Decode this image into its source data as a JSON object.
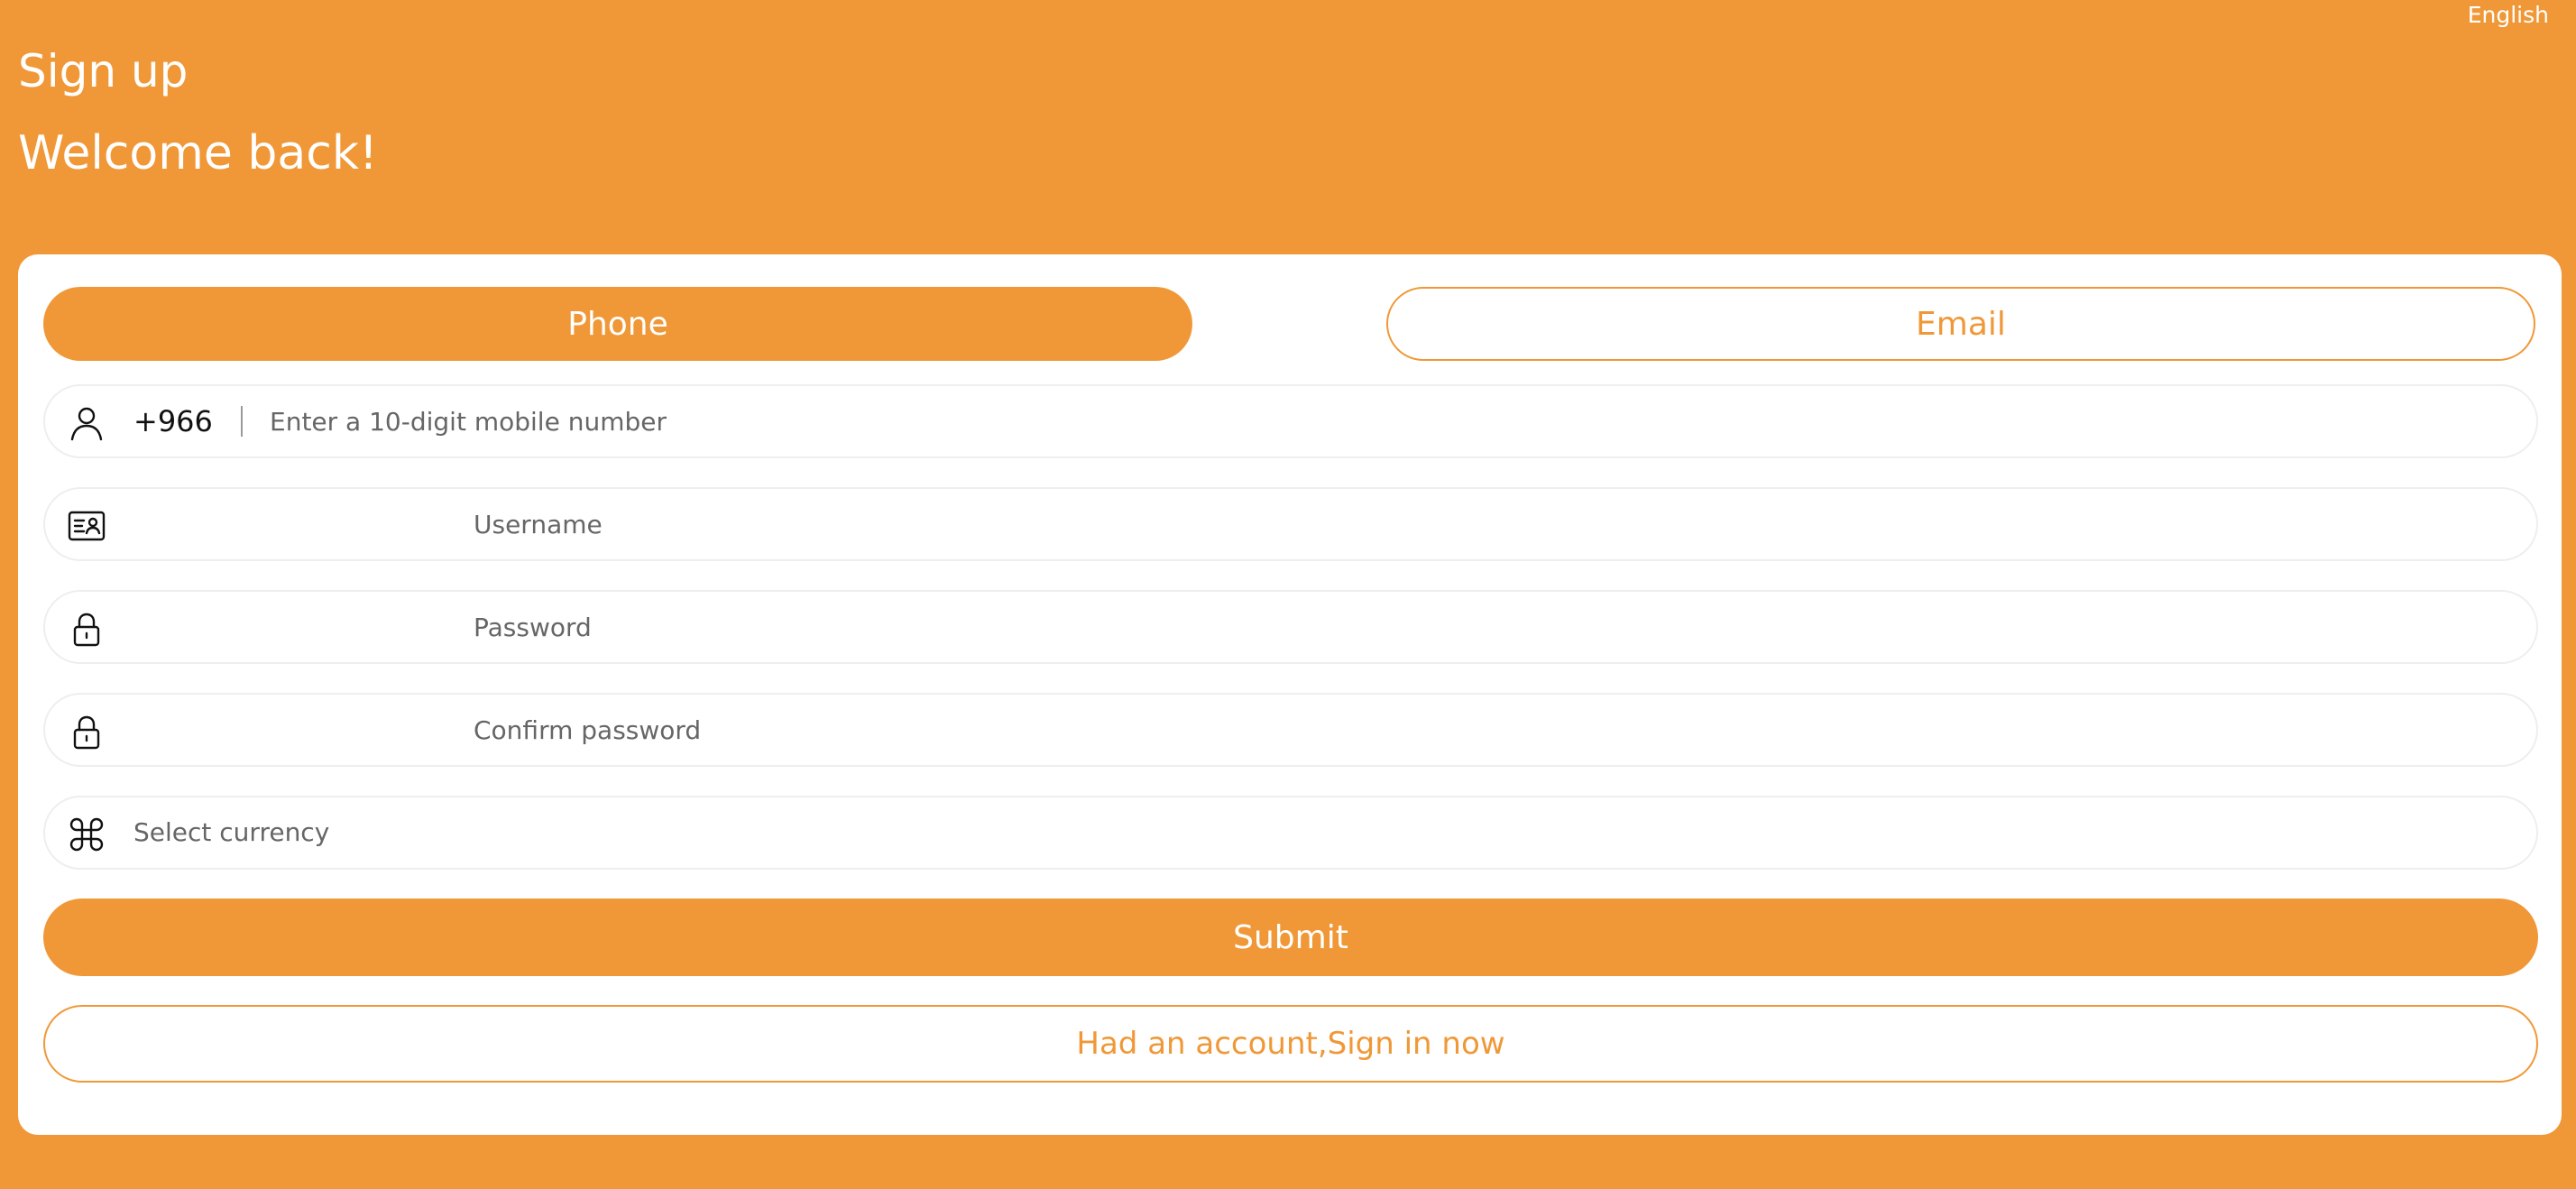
{
  "header": {
    "language": "English",
    "title": "Sign up",
    "subtitle": "Welcome back!"
  },
  "tabs": [
    {
      "label": "Phone",
      "active": true
    },
    {
      "label": "Email",
      "active": false
    }
  ],
  "form": {
    "phone": {
      "icon": "user-icon",
      "country_code": "+966",
      "placeholder": "Enter a 10-digit mobile number",
      "value": ""
    },
    "username": {
      "icon": "id-card-icon",
      "placeholder": "Username",
      "value": ""
    },
    "password": {
      "icon": "lock-icon",
      "placeholder": "Password",
      "value": ""
    },
    "confirm_password": {
      "icon": "lock-icon",
      "placeholder": "Confirm password",
      "value": ""
    },
    "currency": {
      "icon": "command-icon",
      "placeholder": "Select currency"
    }
  },
  "actions": {
    "submit_label": "Submit",
    "signin_label": "Had an account,Sign in now"
  },
  "colors": {
    "accent": "#F09837",
    "card": "#FFFFFF",
    "field_border": "#EEEEEE"
  }
}
